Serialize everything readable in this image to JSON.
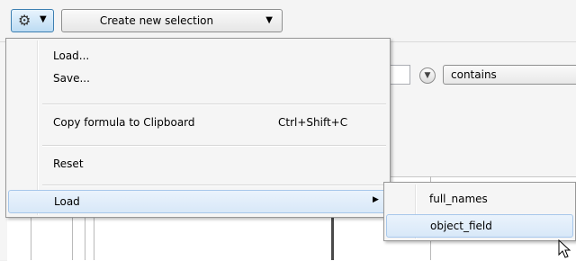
{
  "toolbar": {
    "gear_icon": "gear-icon",
    "create_selection_label": "Create new selection"
  },
  "filter": {
    "operator_value": "contains"
  },
  "context_menu": {
    "items": [
      {
        "label": "Load..."
      },
      {
        "label": "Save..."
      },
      {
        "label": "Copy formula to Clipboard",
        "shortcut": "Ctrl+Shift+C"
      },
      {
        "label": "Reset"
      },
      {
        "label": "Load"
      }
    ]
  },
  "submenu": {
    "items": [
      {
        "label": "full_names"
      },
      {
        "label": "object_field"
      }
    ]
  },
  "colors": {
    "highlight": "#d8e8f8",
    "button_blue": "#bcdcf3"
  }
}
